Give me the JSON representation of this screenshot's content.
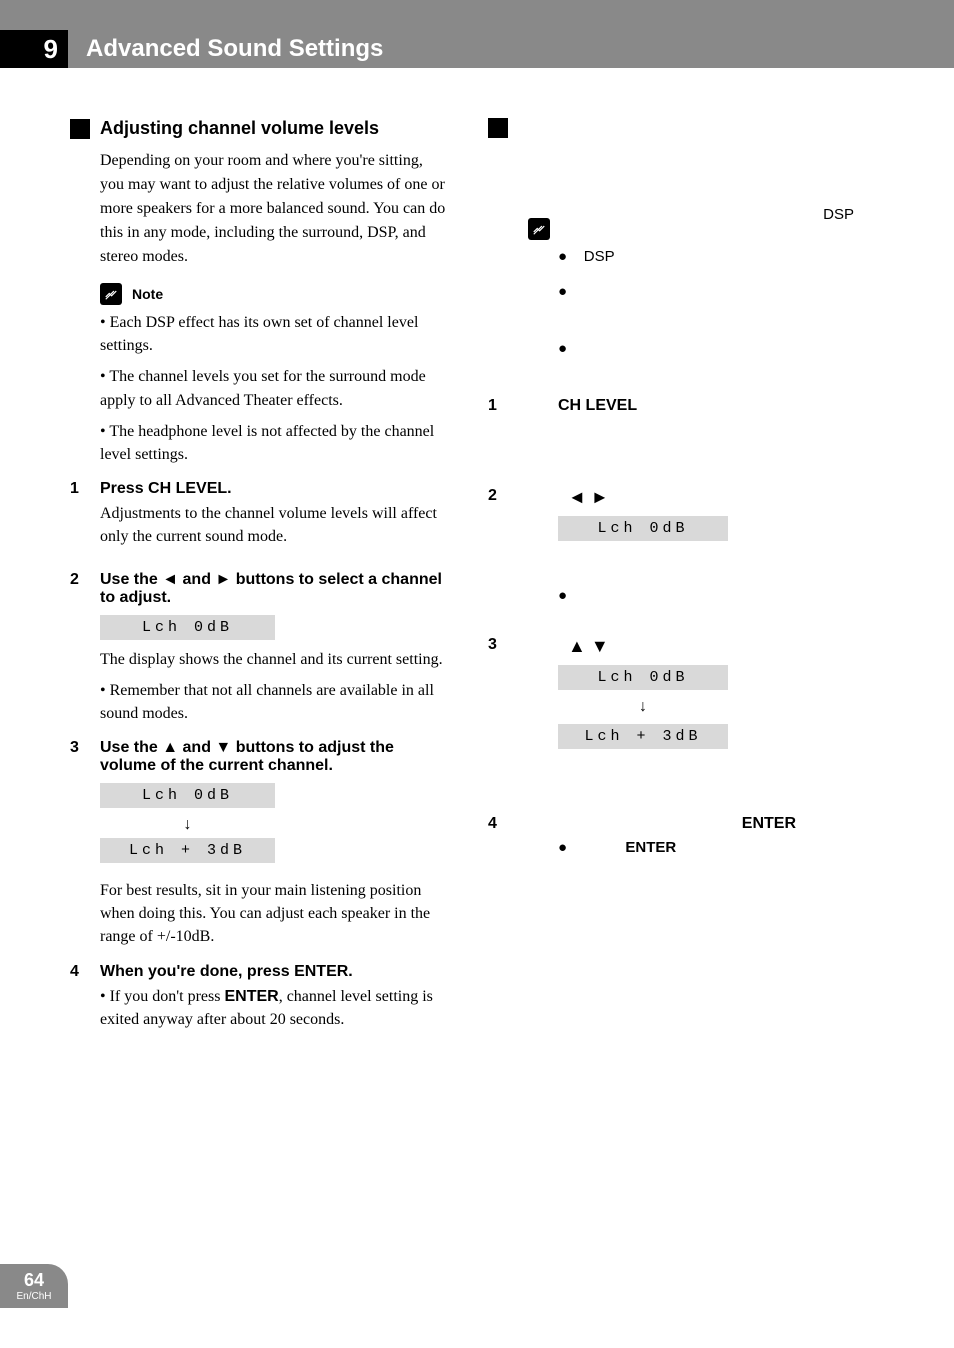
{
  "chapter": {
    "number": "9",
    "title": "Advanced Sound Settings"
  },
  "left": {
    "section_heading": "Adjusting channel volume levels",
    "intro": "Depending on your room and where you're sitting, you may want to adjust the relative volumes of one or more speakers for a more balanced sound. You can do this in any mode, including the surround, DSP, and stereo modes.",
    "note_label": "Note",
    "note_bullets": [
      "•   Each DSP effect has its own set of channel level settings.",
      "•   The channel levels you set for the surround mode apply to all Advanced Theater effects.",
      "•   The headphone level is not affected by the channel level settings."
    ],
    "steps": [
      {
        "n": "1",
        "heading": "Press CH LEVEL.",
        "text": "Adjustments to the channel volume levels will affect only the current sound mode."
      },
      {
        "n": "2",
        "heading": "Use the ◄ and ► buttons to select a channel to adjust.",
        "lcd1": "Lch   0dB",
        "after_lcd": "The display shows the channel and its current setting.",
        "bullet": "•   Remember that not all channels are available in all sound modes."
      },
      {
        "n": "3",
        "heading": "Use the ▲ and ▼ buttons to adjust the volume of the current channel.",
        "lcd1": "Lch   0dB",
        "arrow": "↓",
        "lcd2": "Lch + 3dB",
        "after": "For best results, sit in your main listening position when doing this. You can adjust each speaker in the range of +/-10dB."
      },
      {
        "n": "4",
        "heading": "When you're done, press ENTER.",
        "bullet_prefix": "•   If you don't press ",
        "bullet_bold": "ENTER",
        "bullet_suffix": ", channel level setting is exited anyway after about 20 seconds."
      }
    ]
  },
  "right": {
    "dsp_top": "DSP",
    "bullet_dsp": "DSP",
    "step1_label": "CH LEVEL",
    "arrows2": "◄   ►",
    "lcd2": "Lch   0dB",
    "arrows3": "▲   ▼",
    "lcd3a": "Lch   0dB",
    "arrow_down": "↓",
    "lcd3b": "Lch + 3dB",
    "step4_enter": "ENTER",
    "bullet4_enter": "ENTER"
  },
  "footer": {
    "page": "64",
    "lang": "En/ChH"
  }
}
